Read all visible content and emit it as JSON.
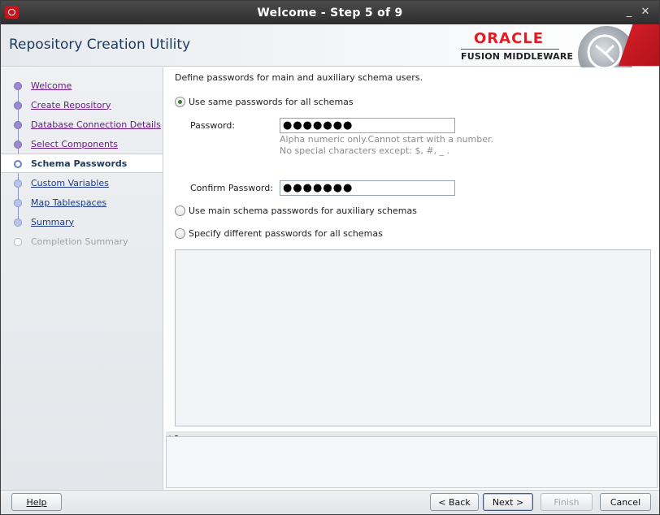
{
  "window": {
    "title": "Welcome - Step 5 of 9",
    "minimize_glyph": "_",
    "close_glyph": "✕"
  },
  "header": {
    "app_title": "Repository Creation Utility",
    "brand": "ORACLE",
    "brand_sub": "FUSION MIDDLEWARE",
    "brand_color": "#e31b23"
  },
  "sidebar": {
    "items": [
      {
        "label": "Welcome",
        "state": "visited"
      },
      {
        "label": "Create Repository",
        "state": "visited"
      },
      {
        "label": "Database Connection Details",
        "state": "visited"
      },
      {
        "label": "Select Components",
        "state": "visited"
      },
      {
        "label": "Schema Passwords",
        "state": "current"
      },
      {
        "label": "Custom Variables",
        "state": "todo"
      },
      {
        "label": "Map Tablespaces",
        "state": "todo"
      },
      {
        "label": "Summary",
        "state": "todo"
      },
      {
        "label": "Completion Summary",
        "state": "disabled"
      }
    ]
  },
  "main": {
    "intro": "Define passwords for main and auxiliary schema users.",
    "options": [
      {
        "label": "Use same passwords for all schemas",
        "checked": true
      },
      {
        "label": "Use main schema passwords for auxiliary schemas",
        "checked": false
      },
      {
        "label": "Specify different passwords for all schemas",
        "checked": false
      }
    ],
    "password_label": "Password:",
    "password_value": "●●●●●●●",
    "hint_line1": "Alpha numeric only.Cannot start with a number.",
    "hint_line2": "No special characters except: $, #, _ .",
    "confirm_label": "Confirm Password:",
    "confirm_value": "●●●●●●●"
  },
  "footer": {
    "help": "Help",
    "back": "< Back",
    "next": "Next >",
    "finish": "Finish",
    "cancel": "Cancel"
  }
}
